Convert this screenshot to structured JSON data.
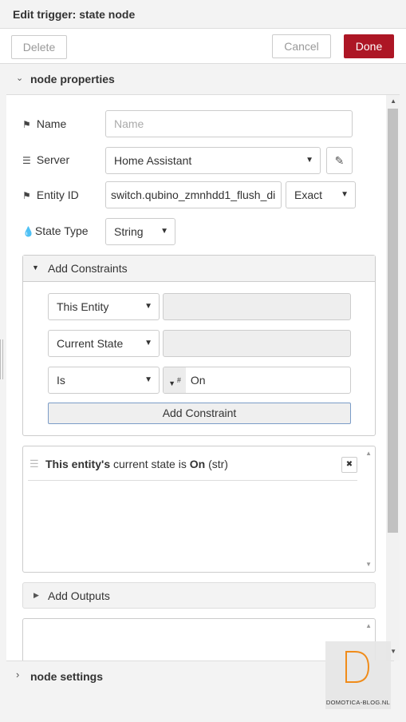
{
  "header": {
    "title": "Edit trigger: state node"
  },
  "toolbar": {
    "delete_label": "Delete",
    "cancel_label": "Cancel",
    "done_label": "Done",
    "done_color": "#ad1625"
  },
  "sections": {
    "properties_label": "node properties",
    "settings_label": "node settings"
  },
  "form": {
    "name_label": "Name",
    "name_placeholder": "Name",
    "server_label": "Server",
    "server_value": "Home Assistant",
    "entity_label": "Entity ID",
    "entity_value": "switch.qubino_zmnhdd1_flush_di",
    "entity_match": "Exact",
    "state_type_label": "State Type",
    "state_type_value": "String"
  },
  "constraints": {
    "header": "Add Constraints",
    "target_type": "This Entity",
    "property_type": "Current State",
    "comparator": "Is",
    "compare_value": "On",
    "add_button": "Add Constraint",
    "list": [
      {
        "subject": "This entity's",
        "middle": "current state is",
        "value": "On",
        "suffix": "(str)"
      }
    ]
  },
  "outputs": {
    "header": "Add Outputs"
  },
  "watermark": {
    "brand": "DOMOTICA-BLOG.NL",
    "accent": "#f08c1a"
  }
}
